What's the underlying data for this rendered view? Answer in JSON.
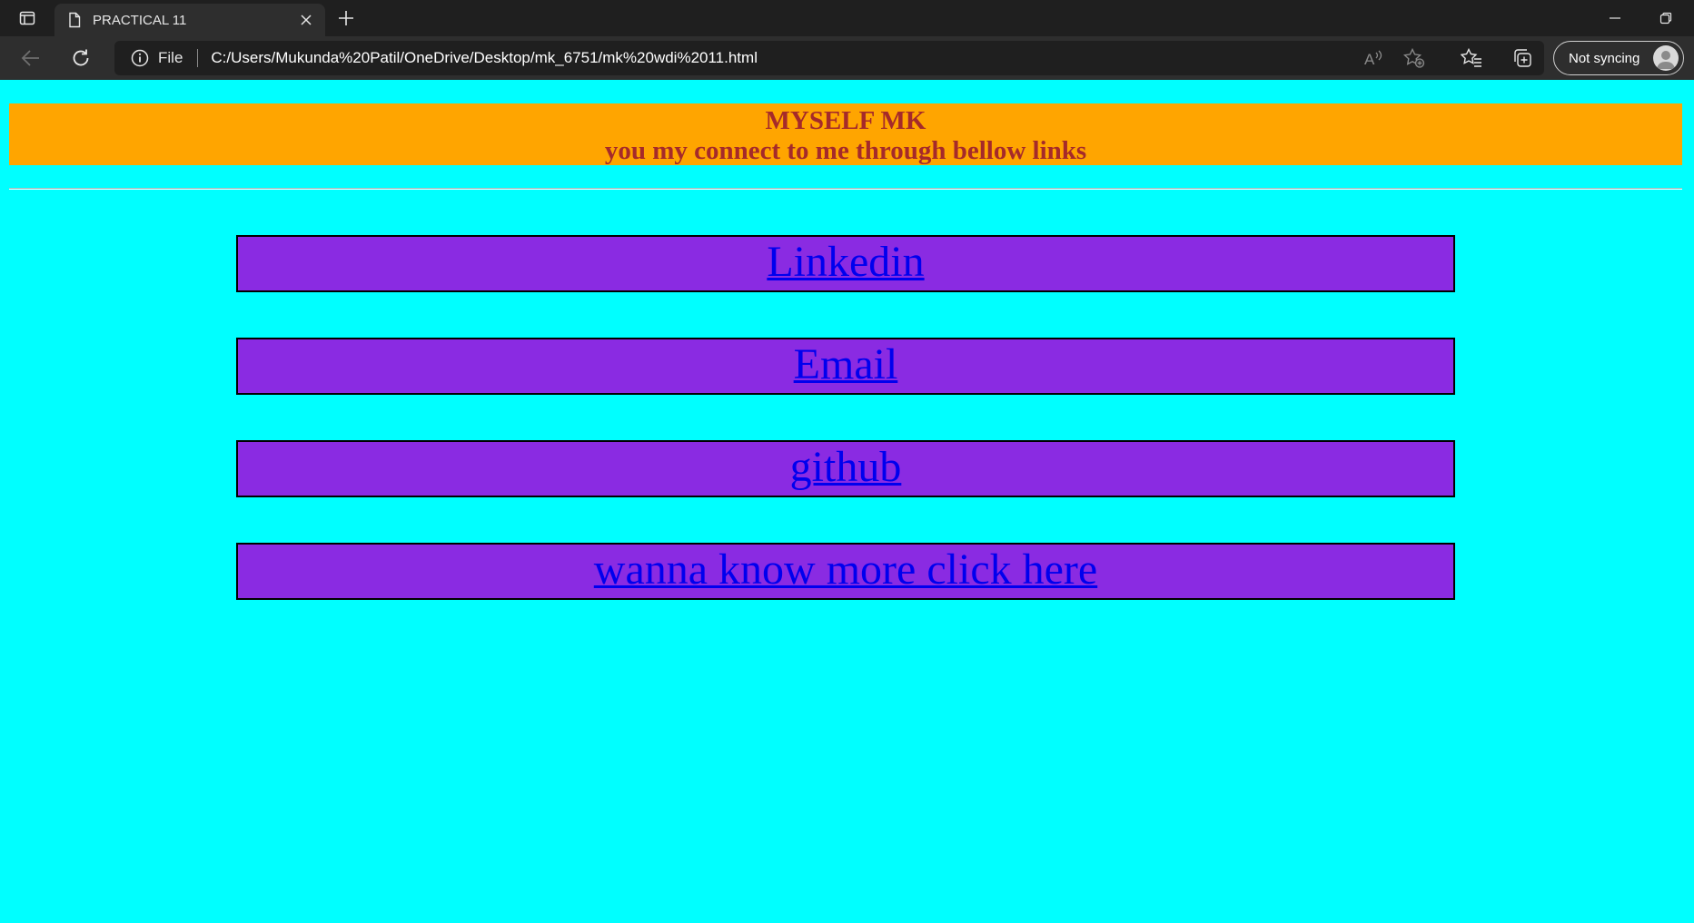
{
  "browser": {
    "tab_title": "PRACTICAL 11",
    "address": {
      "scheme_label": "File",
      "url": "C:/Users/Mukunda%20Patil/OneDrive/Desktop/mk_6751/mk%20wdi%2011.html"
    },
    "profile_label": "Not syncing"
  },
  "page": {
    "heading": "MYSELF MK",
    "subheading": "you my connect to me through bellow links",
    "links": [
      {
        "label": "Linkedin"
      },
      {
        "label": "Email"
      },
      {
        "label": "github"
      },
      {
        "label": "wanna know more click here"
      }
    ]
  },
  "colors": {
    "background": "#00ffff",
    "header_bg": "#ffa500",
    "header_text": "#a52a2a",
    "link_box": "#8a2be2",
    "link_text": "#0000ee"
  }
}
